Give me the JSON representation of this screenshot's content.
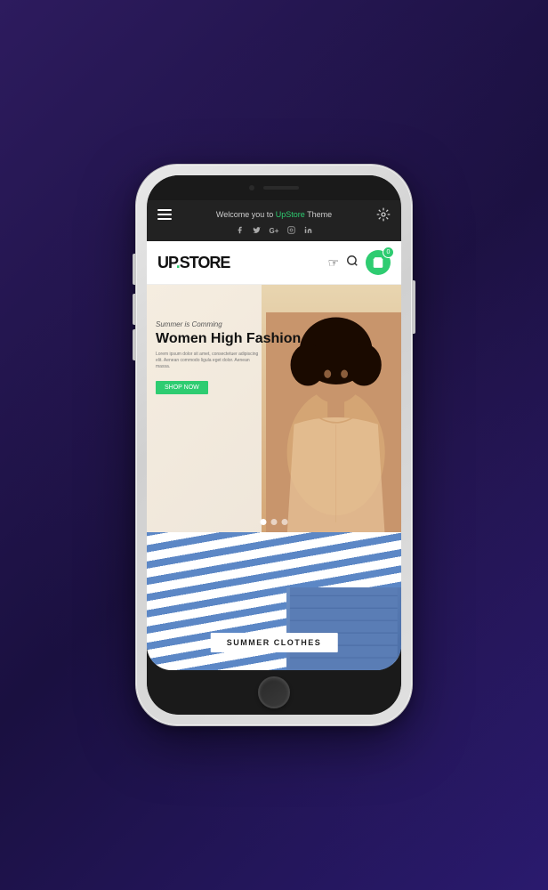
{
  "background": {
    "color": "#2d1b5e"
  },
  "phone": {
    "top_bar": {
      "camera_visible": true,
      "speaker_visible": true
    },
    "nav": {
      "welcome_text": "Welcome you to ",
      "brand": "UpStore",
      "suffix": " Theme",
      "social_icons": [
        "f",
        "𝕏",
        "G+",
        "♡",
        "in"
      ]
    },
    "header": {
      "logo_text": "UP.STORE",
      "cart_count": "0"
    },
    "hero": {
      "sub_text": "Summer is Comming",
      "title_line1": "Women High Fashion",
      "description": "Lorem ipsum dolor sit amet, consectetuer adipiscing elit. Aenean commodo ligula eget dolor. Aenean massa.",
      "button_label": "SHOP NOW",
      "dot_count": 3,
      "active_dot": 0
    },
    "summer": {
      "label": "SUMMER CLOTHES"
    }
  }
}
